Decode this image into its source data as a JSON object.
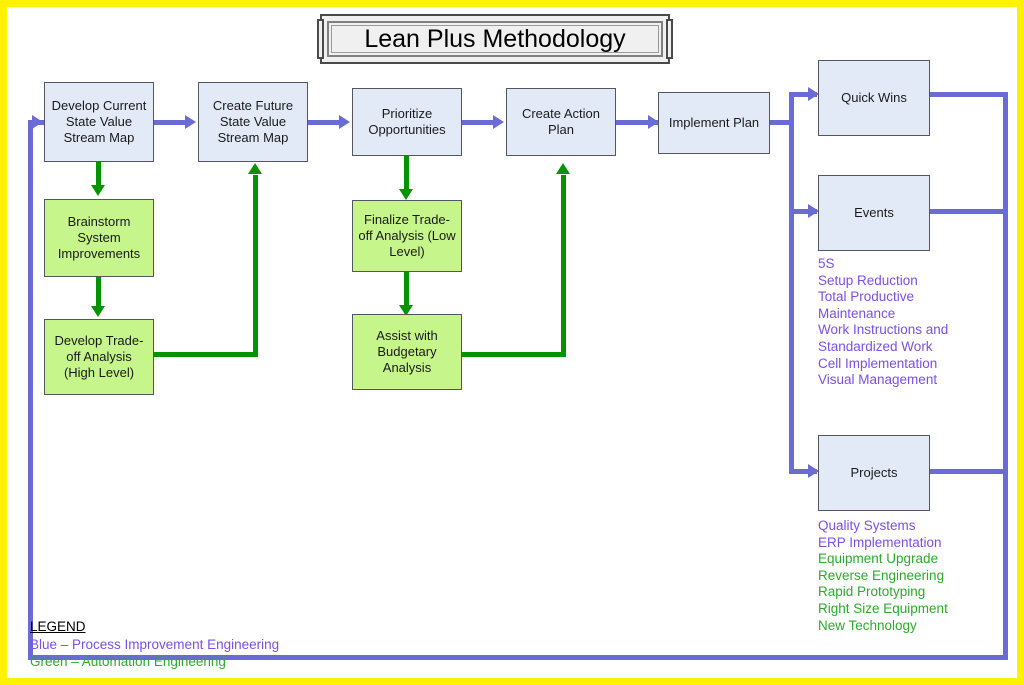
{
  "diagram": {
    "title": "Lean Plus Methodology",
    "colors": {
      "process_blue_fill": "#E3EAF7",
      "automation_green_fill": "#C6F58C",
      "connector_blue": "#6B6BD6",
      "connector_green": "#029402",
      "legend_blue_text": "#7B4FE8",
      "legend_green_text": "#2EA82E",
      "outer_frame": "#FFF200"
    },
    "process_boxes": [
      {
        "id": "develop-current-state",
        "label": "Develop Current State Value Stream Map",
        "type": "process"
      },
      {
        "id": "create-future-state",
        "label": "Create Future State Value Stream Map",
        "type": "process"
      },
      {
        "id": "prioritize-opportunities",
        "label": "Prioritize Opportunities",
        "type": "process"
      },
      {
        "id": "create-action-plan",
        "label": "Create Action Plan",
        "type": "process"
      },
      {
        "id": "implement-plan",
        "label": "Implement Plan",
        "type": "process"
      }
    ],
    "automation_boxes": [
      {
        "id": "brainstorm-system-improvements",
        "label": "Brainstorm System Improvements"
      },
      {
        "id": "develop-tradeoff-analysis",
        "label": "Develop Trade-off Analysis (High Level)"
      },
      {
        "id": "finalize-tradeoff-analysis",
        "label": "Finalize Trade-off Analysis (Low Level)"
      },
      {
        "id": "assist-budgetary-analysis",
        "label": "Assist with Budgetary Analysis"
      }
    ],
    "outcome_boxes": [
      {
        "id": "quick-wins",
        "label": "Quick Wins"
      },
      {
        "id": "events",
        "label": "Events"
      },
      {
        "id": "projects",
        "label": "Projects"
      }
    ],
    "events_list": [
      {
        "text": "5S",
        "color": "blue"
      },
      {
        "text": "Setup Reduction",
        "color": "blue"
      },
      {
        "text": "Total Productive",
        "color": "blue"
      },
      {
        "text": "Maintenance",
        "color": "blue"
      },
      {
        "text": "Work Instructions and",
        "color": "blue"
      },
      {
        "text": "Standardized Work",
        "color": "blue"
      },
      {
        "text": "Cell Implementation",
        "color": "blue"
      },
      {
        "text": "Visual Management",
        "color": "blue"
      }
    ],
    "projects_list": [
      {
        "text": "Quality Systems",
        "color": "blue"
      },
      {
        "text": "ERP Implementation",
        "color": "blue"
      },
      {
        "text": "Equipment Upgrade",
        "color": "green"
      },
      {
        "text": "Reverse Engineering",
        "color": "green"
      },
      {
        "text": "Rapid Prototyping",
        "color": "green"
      },
      {
        "text": "Right Size Equipment",
        "color": "green"
      },
      {
        "text": "New Technology",
        "color": "green"
      }
    ],
    "legend": {
      "title": "LEGEND",
      "blue_entry": "Blue – Process Improvement Engineering",
      "green_entry": "Green – Automation Engineering"
    }
  }
}
